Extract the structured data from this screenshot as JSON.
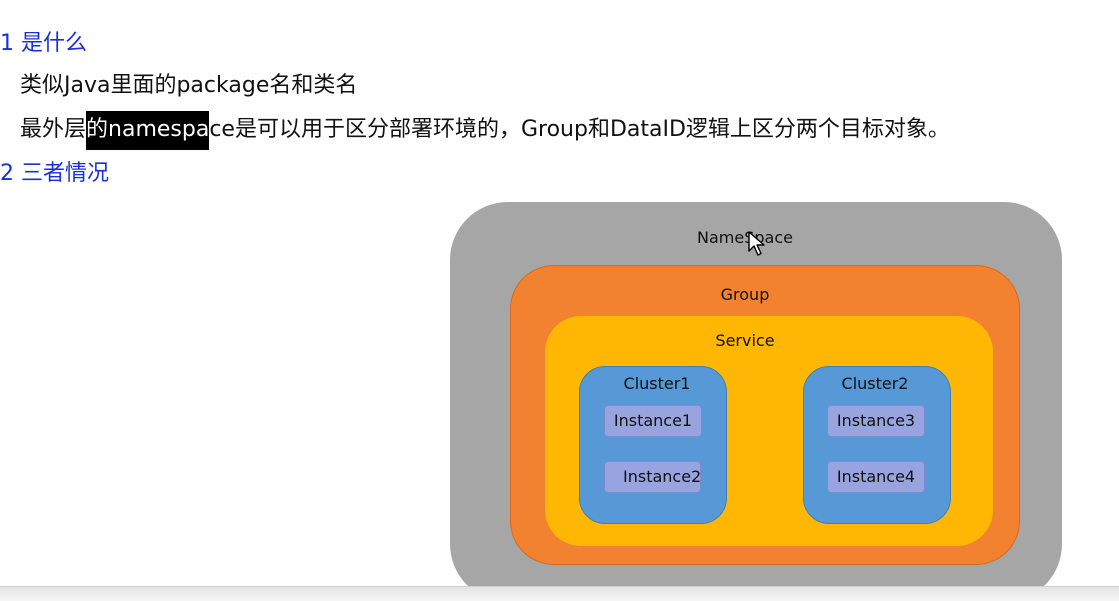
{
  "section1": {
    "heading": "1 是什么",
    "line1": "类似Java里面的package名和类名",
    "line2_before": "最外层",
    "line2_highlight": "的namespa",
    "line2_after": "ce是可以用于区分部署环境的，Group和DataID逻辑上区分两个目标对象。"
  },
  "section2": {
    "heading": "2 三者情况"
  },
  "diagram": {
    "namespace": "NameSpace",
    "group": "Group",
    "service": "Service",
    "clusters": [
      {
        "label": "Cluster1",
        "instances": [
          "Instance1",
          "Instance2"
        ]
      },
      {
        "label": "Cluster2",
        "instances": [
          "Instance3",
          "Instance4"
        ]
      }
    ],
    "colors": {
      "namespace": "#a6a6a6",
      "group": "#f28230",
      "service": "#ffb703",
      "cluster": "#5799d6",
      "instance": "#97a4df",
      "heading": "#1a2fd8"
    }
  }
}
